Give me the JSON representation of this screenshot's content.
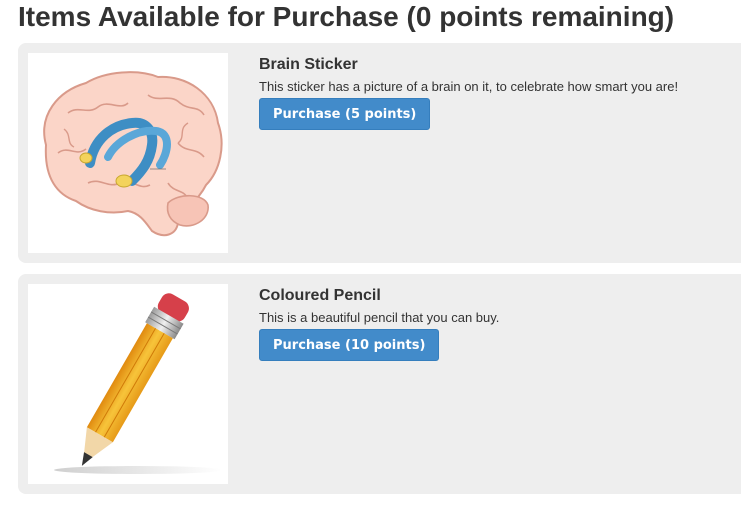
{
  "header": {
    "title": "Items Available for Purchase (0 points remaining)"
  },
  "items": [
    {
      "name": "Brain Sticker",
      "description": "This sticker has a picture of a brain on it, to celebrate how smart you are!",
      "button_label": "Purchase (5 points)",
      "image": "brain-illustration"
    },
    {
      "name": "Coloured Pencil",
      "description": "This is a beautiful pencil that you can buy.",
      "button_label": "Purchase (10 points)",
      "image": "pencil-illustration"
    }
  ],
  "colors": {
    "card_background": "#eeeeee",
    "button_background": "#428bca",
    "text": "#333333"
  }
}
